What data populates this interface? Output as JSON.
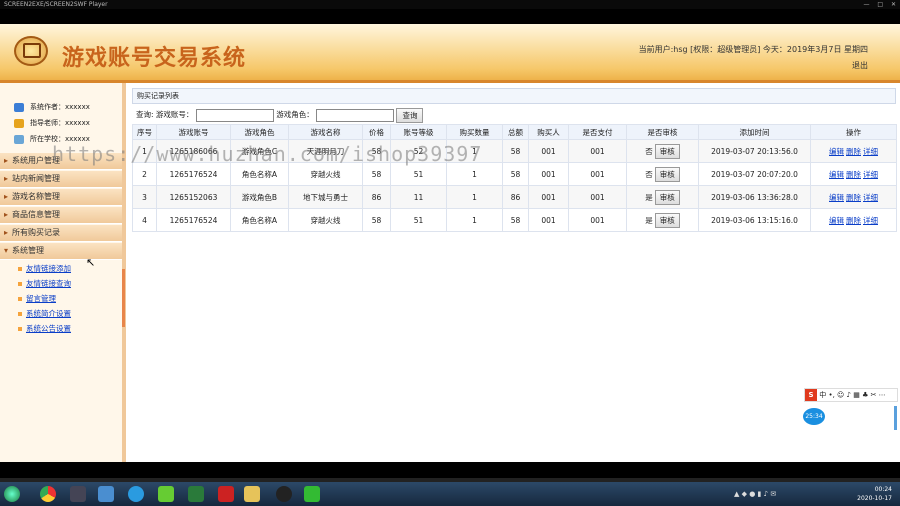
{
  "player": {
    "title": "SCREEN2EXE/SCREEN2SWF Player",
    "controls": [
      "—",
      "□",
      "✕"
    ]
  },
  "header": {
    "app_title": "游戏账号交易系统",
    "user_line": "当前用户:hsg [权限：超级管理员] 今天：2019年3月7日 星期四",
    "logout": "退出"
  },
  "sidebar": {
    "info": [
      {
        "label": "系统作者：xxxxxx",
        "icon": "author-icon",
        "color": "#3c7ed6"
      },
      {
        "label": "指导老师：xxxxxx",
        "icon": "teacher-icon",
        "color": "#e6a31c"
      },
      {
        "label": "所在学校：xxxxxx",
        "icon": "school-icon",
        "color": "#6aa6d6"
      }
    ],
    "groups": [
      {
        "label": "系统用户管理"
      },
      {
        "label": "站内新闻管理"
      },
      {
        "label": "游戏名称管理"
      },
      {
        "label": "商品信息管理"
      },
      {
        "label": "所有购买记录"
      },
      {
        "label": "系统管理"
      }
    ],
    "sub_items": [
      {
        "label": "友情链接添加"
      },
      {
        "label": "友情链接查询"
      },
      {
        "label": "留言管理"
      },
      {
        "label": "系统简介设置"
      },
      {
        "label": "系统公告设置"
      }
    ]
  },
  "main": {
    "panel_title": "购买记录列表",
    "search": {
      "prefix": "查询:",
      "account_label": "游戏账号：",
      "account_value": "",
      "role_label": "游戏角色：",
      "role_value": "",
      "button": "查询"
    },
    "columns": [
      "序号",
      "游戏账号",
      "游戏角色",
      "游戏名称",
      "价格",
      "账号等级",
      "购买数量",
      "总额",
      "购买人",
      "是否支付",
      "是否审核",
      "添加时间",
      "操作"
    ],
    "rows": [
      {
        "no": "1",
        "account": "1265186066",
        "role": "游戏角色C",
        "game": "天涯明月刀",
        "price": "58",
        "level": "52",
        "qty": "1",
        "total": "58",
        "buyer": "001",
        "paid": "001",
        "audited": "否",
        "audit_btn": "审核",
        "time": "2019-03-07 20:13:56.0",
        "ops": [
          "编辑",
          "删除",
          "详细"
        ]
      },
      {
        "no": "2",
        "account": "1265176524",
        "role": "角色名称A",
        "game": "穿越火线",
        "price": "58",
        "level": "51",
        "qty": "1",
        "total": "58",
        "buyer": "001",
        "paid": "001",
        "audited": "否",
        "audit_btn": "审核",
        "time": "2019-03-07 20:07:20.0",
        "ops": [
          "编辑",
          "删除",
          "详细"
        ]
      },
      {
        "no": "3",
        "account": "1265152063",
        "role": "游戏角色B",
        "game": "地下城与勇士",
        "price": "86",
        "level": "11",
        "qty": "1",
        "total": "86",
        "buyer": "001",
        "paid": "001",
        "audited": "是",
        "audit_btn": "审核",
        "time": "2019-03-06 13:36:28.0",
        "ops": [
          "编辑",
          "删除",
          "详细"
        ]
      },
      {
        "no": "4",
        "account": "1265176524",
        "role": "角色名称A",
        "game": "穿越火线",
        "price": "58",
        "level": "51",
        "qty": "1",
        "total": "58",
        "buyer": "001",
        "paid": "001",
        "audited": "是",
        "audit_btn": "审核",
        "time": "2019-03-06 13:15:16.0",
        "ops": [
          "编辑",
          "删除",
          "详细"
        ]
      }
    ]
  },
  "watermark": "https://www.huzhan.com/ishop39397",
  "ime": {
    "logo": "S",
    "text": "中 •, ☺ ♪ ▦ ♣ ✂ ⋯"
  },
  "time_bubble": "25:34",
  "tray": {
    "time": "00:24",
    "date": "2020-10-17"
  }
}
